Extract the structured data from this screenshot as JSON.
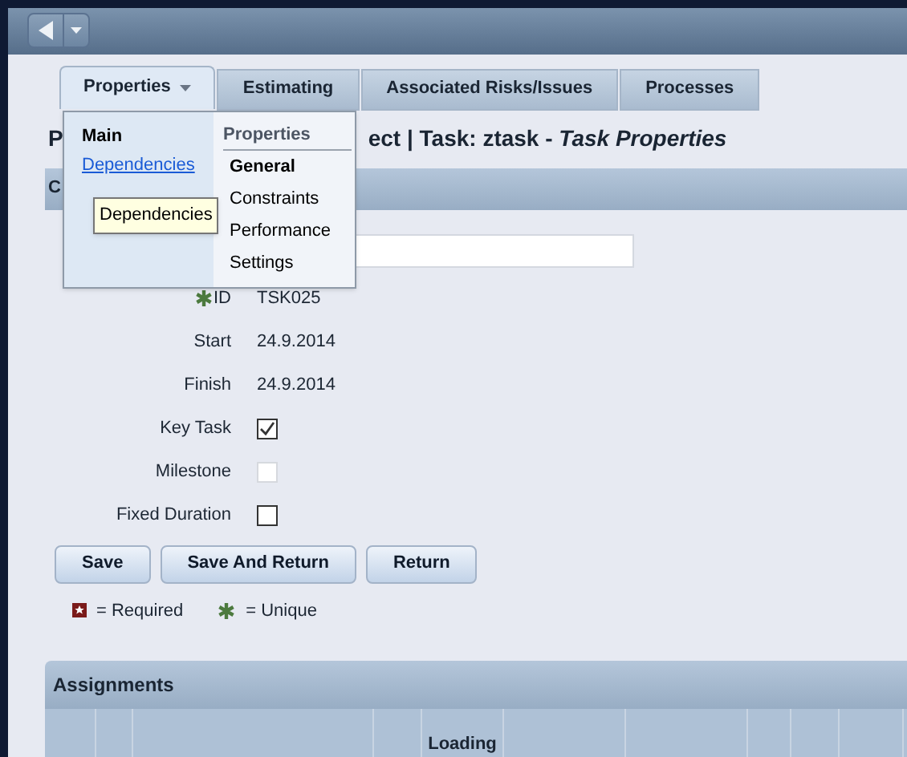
{
  "tabs": [
    {
      "label": "Properties",
      "selected": true,
      "dropdown": true
    },
    {
      "label": "Estimating",
      "selected": false,
      "dropdown": false
    },
    {
      "label": "Associated Risks/Issues",
      "selected": false,
      "dropdown": false
    },
    {
      "label": "Processes",
      "selected": false,
      "dropdown": false
    }
  ],
  "menu": {
    "main_heading": "Main",
    "main_links": [
      "Dependencies"
    ],
    "properties_heading": "Properties",
    "properties_items": [
      {
        "label": "General",
        "selected": true
      },
      {
        "label": "Constraints",
        "selected": false
      },
      {
        "label": "Performance",
        "selected": false
      },
      {
        "label": "Settings",
        "selected": false
      }
    ],
    "tooltip": "Dependencies"
  },
  "title_parts": [
    "P",
    "ect | Task: ztask - *Task Properties*"
  ],
  "section_title": "C",
  "fields": [
    {
      "kind": "input"
    },
    {
      "kind": "text",
      "label": "ID",
      "unique": true,
      "value": "TSK025"
    },
    {
      "kind": "text",
      "label": "Start",
      "unique": false,
      "value": "24.9.2014"
    },
    {
      "kind": "text",
      "label": "Finish",
      "unique": false,
      "value": "24.9.2014"
    },
    {
      "kind": "checkbox",
      "label": "Key Task",
      "checked": true,
      "disabled": false
    },
    {
      "kind": "checkbox",
      "label": "Milestone",
      "checked": false,
      "disabled": true
    },
    {
      "kind": "checkbox",
      "label": "Fixed Duration",
      "checked": false,
      "disabled": false
    }
  ],
  "buttons": [
    "Save",
    "Save And Return",
    "Return"
  ],
  "legend": {
    "required": "= Required",
    "unique": "= Unique"
  },
  "assignments": {
    "title": "Assignments",
    "columns": [
      "",
      "",
      "",
      "",
      "Loading",
      "",
      "",
      "",
      "",
      ""
    ]
  }
}
